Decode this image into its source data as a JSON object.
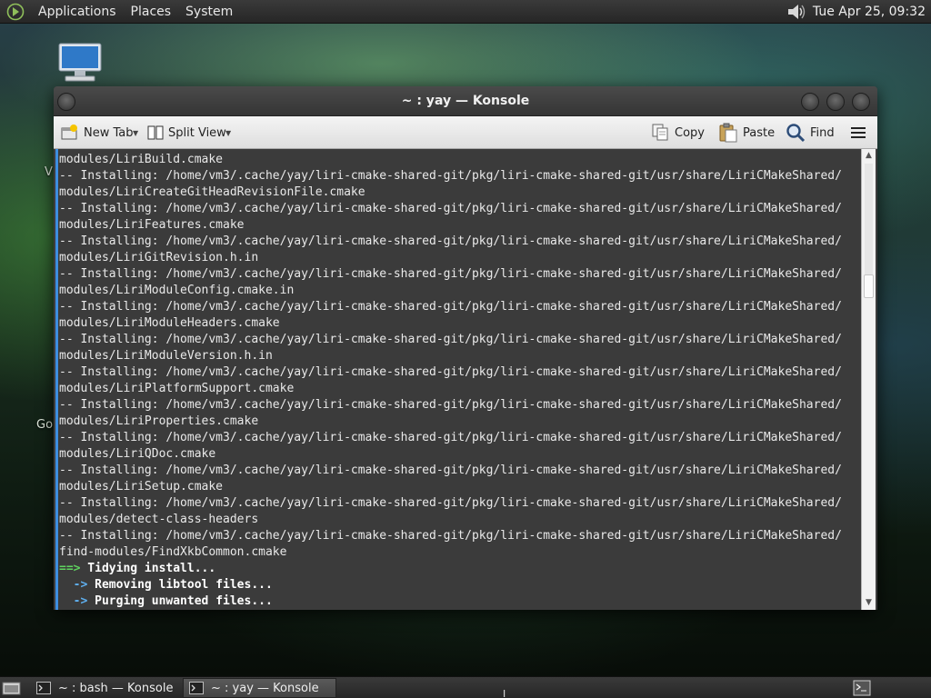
{
  "top_panel": {
    "menus": [
      "Applications",
      "Places",
      "System"
    ],
    "clock": "Tue Apr 25, 09:32",
    "icons": [
      "distro-logo-icon",
      "volume-icon"
    ]
  },
  "desktop": {
    "partial_labels": [
      "V",
      "Go"
    ],
    "icons": [
      "computer-icon"
    ]
  },
  "window": {
    "title": "~ : yay — Konsole",
    "toolbar": {
      "new_tab": "New Tab",
      "split_view": "Split View",
      "copy": "Copy",
      "paste": "Paste",
      "find": "Find"
    },
    "terminal_lines": [
      "modules/LiriBuild.cmake",
      "-- Installing: /home/vm3/.cache/yay/liri-cmake-shared-git/pkg/liri-cmake-shared-git/usr/share/LiriCMakeShared/",
      "modules/LiriCreateGitHeadRevisionFile.cmake",
      "-- Installing: /home/vm3/.cache/yay/liri-cmake-shared-git/pkg/liri-cmake-shared-git/usr/share/LiriCMakeShared/",
      "modules/LiriFeatures.cmake",
      "-- Installing: /home/vm3/.cache/yay/liri-cmake-shared-git/pkg/liri-cmake-shared-git/usr/share/LiriCMakeShared/",
      "modules/LiriGitRevision.h.in",
      "-- Installing: /home/vm3/.cache/yay/liri-cmake-shared-git/pkg/liri-cmake-shared-git/usr/share/LiriCMakeShared/",
      "modules/LiriModuleConfig.cmake.in",
      "-- Installing: /home/vm3/.cache/yay/liri-cmake-shared-git/pkg/liri-cmake-shared-git/usr/share/LiriCMakeShared/",
      "modules/LiriModuleHeaders.cmake",
      "-- Installing: /home/vm3/.cache/yay/liri-cmake-shared-git/pkg/liri-cmake-shared-git/usr/share/LiriCMakeShared/",
      "modules/LiriModuleVersion.h.in",
      "-- Installing: /home/vm3/.cache/yay/liri-cmake-shared-git/pkg/liri-cmake-shared-git/usr/share/LiriCMakeShared/",
      "modules/LiriPlatformSupport.cmake",
      "-- Installing: /home/vm3/.cache/yay/liri-cmake-shared-git/pkg/liri-cmake-shared-git/usr/share/LiriCMakeShared/",
      "modules/LiriProperties.cmake",
      "-- Installing: /home/vm3/.cache/yay/liri-cmake-shared-git/pkg/liri-cmake-shared-git/usr/share/LiriCMakeShared/",
      "modules/LiriQDoc.cmake",
      "-- Installing: /home/vm3/.cache/yay/liri-cmake-shared-git/pkg/liri-cmake-shared-git/usr/share/LiriCMakeShared/",
      "modules/LiriSetup.cmake",
      "-- Installing: /home/vm3/.cache/yay/liri-cmake-shared-git/pkg/liri-cmake-shared-git/usr/share/LiriCMakeShared/",
      "modules/detect-class-headers",
      "-- Installing: /home/vm3/.cache/yay/liri-cmake-shared-git/pkg/liri-cmake-shared-git/usr/share/LiriCMakeShared/",
      "find-modules/FindXkbCommon.cmake"
    ],
    "status_lines": [
      {
        "prefix": "==>",
        "prefix_color": "green",
        "text": "Tidying install..."
      },
      {
        "prefix": "  ->",
        "prefix_color": "blue",
        "text": "Removing libtool files..."
      },
      {
        "prefix": "  ->",
        "prefix_color": "blue",
        "text": "Purging unwanted files..."
      }
    ]
  },
  "taskbar": {
    "tasks": [
      {
        "label": "~ : bash — Konsole",
        "active": false
      },
      {
        "label": "~ : yay — Konsole",
        "active": true
      }
    ]
  },
  "colors": {
    "terminal_bg": "#3b3b3b",
    "terminal_fg": "#e9e9e9",
    "arrow_green": "#5fd35f",
    "arrow_blue": "#5fb0f0",
    "focus_accent": "#3d8ee0"
  }
}
